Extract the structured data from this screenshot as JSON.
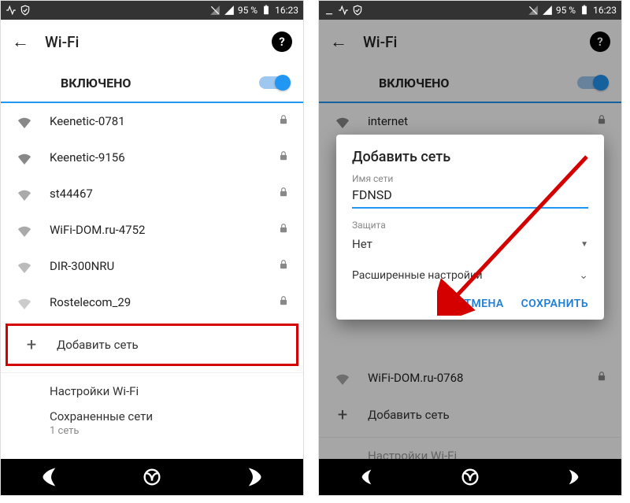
{
  "status": {
    "battery": "95 %",
    "time": "16:23"
  },
  "left": {
    "title": "Wi-Fi",
    "enabled_label": "ВКЛЮЧЕНО",
    "networks": [
      {
        "name": "Keenetic-0781",
        "locked": true
      },
      {
        "name": "Keenetic-9156",
        "locked": true
      },
      {
        "name": "st44467",
        "locked": true
      },
      {
        "name": "WiFi-DOM.ru-4752",
        "locked": true
      },
      {
        "name": "DIR-300NRU",
        "locked": true
      },
      {
        "name": "Rostelecom_29",
        "locked": true
      }
    ],
    "add_network": "Добавить сеть",
    "wifi_settings": "Настройки Wi-Fi",
    "saved_networks": "Сохраненные сети",
    "saved_count": "1 сеть"
  },
  "right": {
    "title": "Wi-Fi",
    "enabled_label": "ВКЛЮЧЕНО",
    "visible_networks": [
      {
        "name": "internet"
      },
      {
        "name": "WiFi-DOM.ru-0768"
      }
    ],
    "add_network": "Добавить сеть",
    "last_row": "Настройки Wi-Fi",
    "dialog": {
      "title": "Добавить сеть",
      "name_label": "Имя сети",
      "name_value": "FDNSD",
      "security_label": "Защита",
      "security_value": "Нет",
      "advanced": "Расширенные настройки",
      "cancel": "ОТМЕНА",
      "save": "СОХРАНИТЬ"
    }
  }
}
